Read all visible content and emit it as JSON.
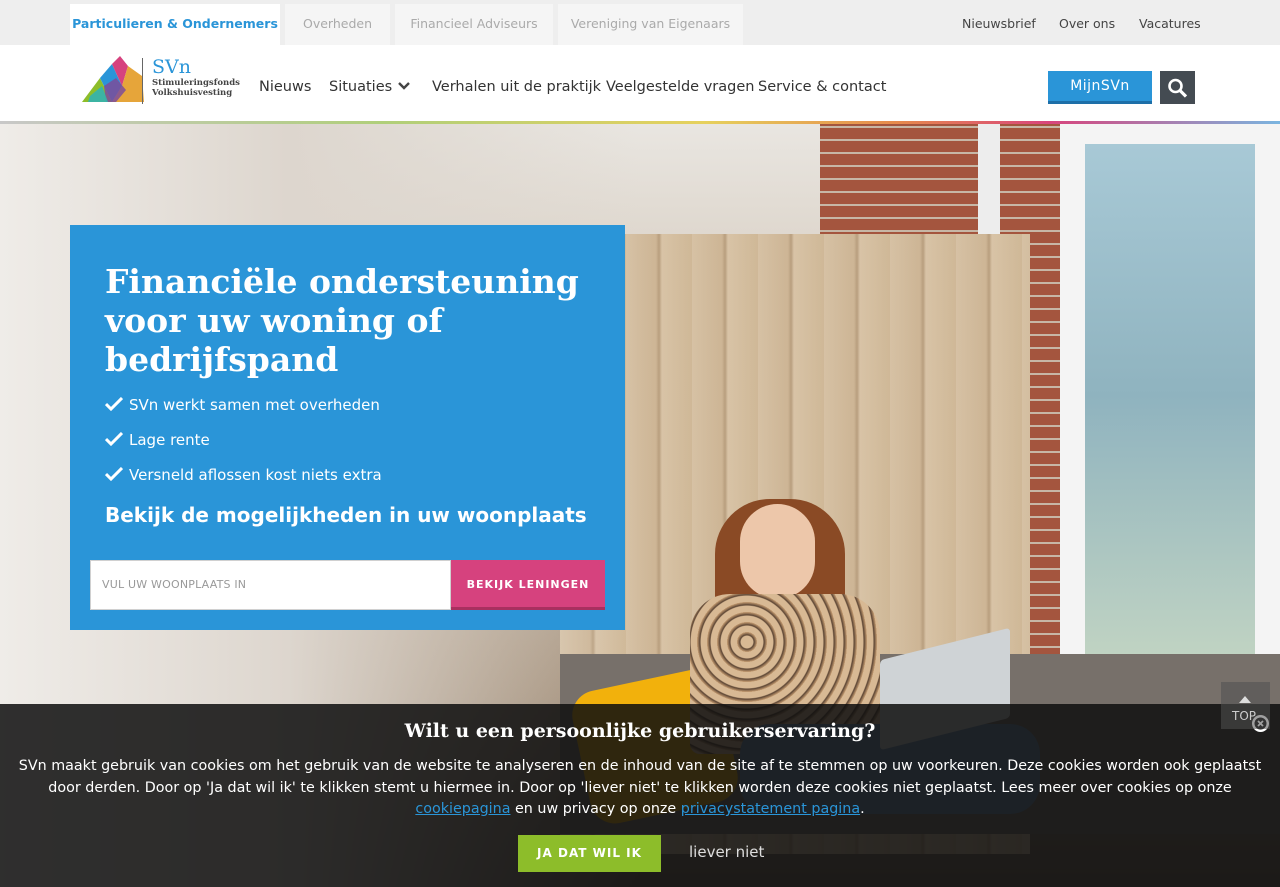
{
  "audience_tabs": [
    {
      "label": "Particulieren & Ondernemers",
      "active": true
    },
    {
      "label": "Overheden",
      "active": false
    },
    {
      "label": "Financieel Adviseurs",
      "active": false
    },
    {
      "label": "Vereniging van Eigenaars",
      "active": false
    }
  ],
  "top_links": [
    "Nieuwsbrief",
    "Over ons",
    "Vacatures"
  ],
  "logo": {
    "name": "SVn",
    "line1": "Stimuleringsfonds",
    "line2": "Volkshuisvesting"
  },
  "nav": [
    "Nieuws",
    "Situaties",
    "Verhalen uit de praktijk",
    "Veelgestelde vragen",
    "Service & contact"
  ],
  "mijn_button": "MijnSVn",
  "search_icon": "search-icon",
  "promo": {
    "title": "Financiële ondersteuning voor uw woning of bedrijfspand",
    "bullets": [
      "SVn werkt samen met overheden",
      "Lage rente",
      "Versneld aflossen kost niets extra"
    ],
    "subtitle": "Bekijk de mogelijkheden in uw woonplaats",
    "input_placeholder": "VUL UW WOONPLAATS IN",
    "button": "BEKIJK LENINGEN"
  },
  "top_button": "TOP",
  "cookie": {
    "title": "Wilt u een persoonlijke gebruikerservaring?",
    "text_before_link1": "SVn maakt gebruik van cookies om het gebruik van de website te analyseren en de inhoud van de site af te stemmen op uw voorkeuren. Deze cookies worden ook geplaatst door derden. Door op 'Ja dat wil ik' te klikken stemt u hiermee in. Door op 'liever niet' te klikken worden deze cookies niet geplaatst. Lees meer over cookies op onze ",
    "link1": "cookiepagina",
    "text_between": " en uw privacy op onze ",
    "link2": "privacystatement pagina",
    "text_after": ".",
    "accept": "JA DAT WIL IK",
    "decline": "liever niet"
  },
  "colors": {
    "brand_blue": "#2a95d8",
    "pink": "#d6427e",
    "green": "#8dbd2a"
  }
}
